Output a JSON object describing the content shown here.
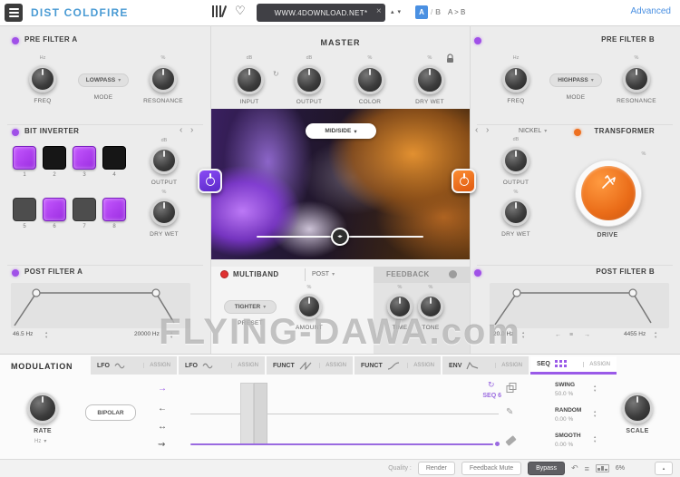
{
  "app": {
    "watermark": "FLYING-DAWA.com"
  },
  "colors": {
    "accent_purple": "#a050e8",
    "accent_orange": "#ee7020",
    "accent_blue": "#4a90e2",
    "accent_red": "#e03030",
    "title_blue": "#4a9bd4"
  },
  "icons": {
    "heart": "♡",
    "close": "×",
    "up": "▴",
    "down": "▾",
    "chevron_down": "▾",
    "chev_left": "‹",
    "chev_right": "›",
    "arrow_right": "→",
    "arrow_left": "←",
    "arrow_both": "↔",
    "arrow_rand": "⇝",
    "link": "↻",
    "loop": "↻",
    "pencil": "✎",
    "undo": "↶",
    "menu": "≡",
    "handle": "◂▸",
    "nav_left": "←",
    "nav_right": "→",
    "chevron_up": "▴"
  },
  "header": {
    "title": "DIST COLDFIRE",
    "preset": "WWW.4DOWNLOAD.NET*",
    "a": "A",
    "sep": "/",
    "b": "B",
    "ab_copy": "A > B",
    "advanced": "Advanced"
  },
  "pre_filter_a": {
    "title": "PRE FILTER A",
    "freq_unit": "Hz",
    "freq_label": "FREQ",
    "mode_value": "LOWPASS",
    "mode_label": "MODE",
    "res_unit": "%",
    "res_label": "RESONANCE"
  },
  "bit_inverter": {
    "title": "BIT INVERTER",
    "pads": [
      {
        "num": "1",
        "state": "on"
      },
      {
        "num": "2",
        "state": "dark"
      },
      {
        "num": "3",
        "state": "on"
      },
      {
        "num": "4",
        "state": "dark"
      },
      {
        "num": "5",
        "state": "gray"
      },
      {
        "num": "6",
        "state": "on"
      },
      {
        "num": "7",
        "state": "gray"
      },
      {
        "num": "8",
        "state": "on"
      }
    ],
    "output_unit": "dB",
    "output_label": "OUTPUT",
    "drywet_unit": "%",
    "drywet_label": "DRY WET"
  },
  "post_filter_a": {
    "title": "POST FILTER A",
    "low": "46.5 Hz",
    "high": "20000 Hz"
  },
  "master": {
    "title": "MASTER",
    "knobs": [
      {
        "unit": "dB",
        "label": "INPUT"
      },
      {
        "unit": "dB",
        "label": "OUTPUT"
      },
      {
        "unit": "%",
        "label": "COLOR"
      },
      {
        "unit": "%",
        "label": "DRY WET"
      }
    ],
    "routing": "MID/SIDE"
  },
  "multiband": {
    "title": "MULTIBAND",
    "position": "POST",
    "preset_value": "TIGHTER",
    "preset_label": "PRESET",
    "amount_unit": "%",
    "amount_label": "AMOUNT"
  },
  "feedback": {
    "title": "FEEDBACK",
    "time_unit": "%",
    "time_label": "TIME",
    "tone_unit": "%",
    "tone_label": "TONE"
  },
  "pre_filter_b": {
    "title": "PRE FILTER B",
    "freq_unit": "Hz",
    "freq_label": "FREQ",
    "mode_value": "HIGHPASS",
    "mode_label": "MODE",
    "res_unit": "%",
    "res_label": "RESONANCE"
  },
  "transformer": {
    "title": "TRANSFORMER",
    "type_value": "NICKEL",
    "output_unit": "dB",
    "output_label": "OUTPUT",
    "drywet_unit": "%",
    "drywet_label": "DRY WET",
    "drive_unit": "%",
    "drive_label": "DRIVE"
  },
  "post_filter_b": {
    "title": "POST FILTER B",
    "low": "20.0 Hz",
    "high": "4455 Hz"
  },
  "modulation": {
    "title": "MODULATION",
    "tabs": [
      {
        "label": "LFO",
        "assign": "ASSIGN"
      },
      {
        "label": "LFO",
        "assign": "ASSIGN"
      },
      {
        "label": "FUNCT",
        "assign": "ASSIGN"
      },
      {
        "label": "FUNCT",
        "assign": "ASSIGN"
      },
      {
        "label": "ENV",
        "assign": "ASSIGN"
      },
      {
        "label": "SEQ",
        "assign": "ASSIGN",
        "selected": true
      }
    ],
    "rate_label": "RATE",
    "rate_unit": "Hz",
    "bipolar": "BIPOLAR",
    "seq_label": "SEQ 6",
    "steppers": [
      {
        "label": "SWING",
        "value": "50.0 %"
      },
      {
        "label": "RANDOM",
        "value": "0.00 %"
      },
      {
        "label": "SMOOTH",
        "value": "0.00 %"
      }
    ],
    "scale_label": "SCALE"
  },
  "statusbar": {
    "quality": "Quality :",
    "render": "Render",
    "feedback_mute": "Feedback Mute",
    "bypass": "Bypass",
    "cpu": "6%"
  }
}
